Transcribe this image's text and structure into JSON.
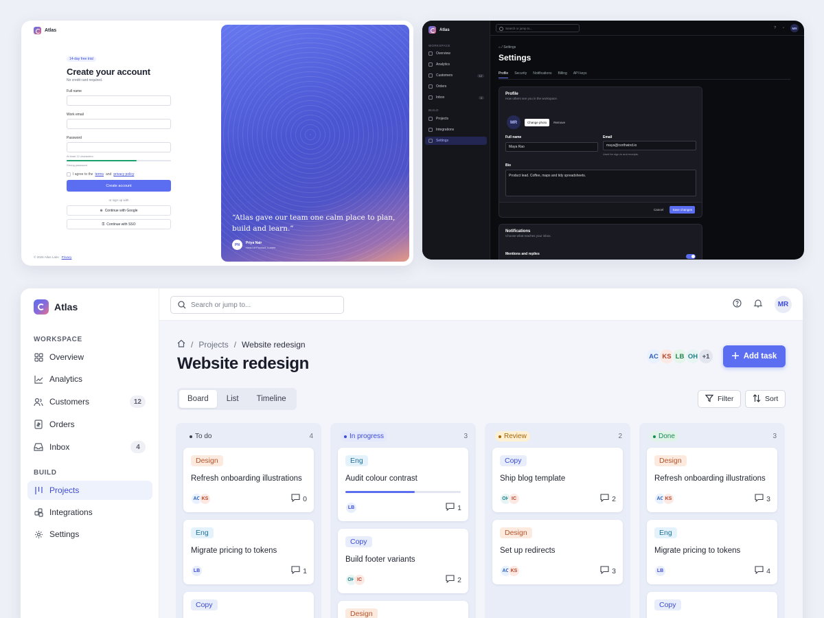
{
  "signup": {
    "brand": "Atlas",
    "trial_badge": "14-day free trial",
    "title": "Create your account",
    "subtitle": "No credit card required.",
    "fields": [
      {
        "label": "Full name"
      },
      {
        "label": "Work email"
      },
      {
        "label": "Password",
        "hint": "At least 12 characters.",
        "strength_text": "Strong password",
        "strength": 0.67
      }
    ],
    "agree": {
      "prefix": "I agree to the",
      "terms": "terms",
      "and": "and",
      "privacy": "privacy policy"
    },
    "submit_label": "Create account",
    "divider": "or sign up with",
    "google_label": "Continue with Google",
    "sso_label": "Continue with SSO",
    "footer_text": "© 2026 Atlas Labs ·",
    "footer_link": "Privacy",
    "quote": "“Atlas gave our team one calm place to plan, build and learn.”",
    "author": {
      "initials": "PN",
      "name": "Priya Nair",
      "role": "Head of Product, Lumen"
    }
  },
  "settings": {
    "brand": "Atlas",
    "search_placeholder": "Search or jump to...",
    "user_initials": "MR",
    "sections": {
      "workspace": "WORKSPACE",
      "build": "BUILD"
    },
    "nav": [
      {
        "label": "Overview"
      },
      {
        "label": "Analytics"
      },
      {
        "label": "Customers",
        "count": "12"
      },
      {
        "label": "Orders"
      },
      {
        "label": "Inbox",
        "count": "4"
      },
      {
        "label": "Projects"
      },
      {
        "label": "Integrations"
      },
      {
        "label": "Settings"
      }
    ],
    "breadcrumb": "Settings",
    "title": "Settings",
    "tabs": [
      "Profile",
      "Security",
      "Notifications",
      "Billing",
      "API keys"
    ],
    "profile": {
      "heading": "Profile",
      "sub": "How others see you in the workspace.",
      "avatar": "MR",
      "change_photo": "Change photo",
      "remove": "Remove",
      "full_name_label": "Full name",
      "full_name": "Maya Rao",
      "email_label": "Email",
      "email": "maya@northwind.io",
      "email_help": "Used for sign-in and receipts.",
      "bio_label": "Bio",
      "bio": "Product lead. Coffee, maps and tidy spreadsheets.",
      "cancel": "Cancel",
      "save": "Save changes"
    },
    "notifications": {
      "heading": "Notifications",
      "sub": "Choose what reaches your inbox.",
      "item": "Mentions and replies",
      "item_on": true
    }
  },
  "board": {
    "brand": "Atlas",
    "sections": {
      "workspace": "WORKSPACE",
      "build": "BUILD"
    },
    "nav": [
      {
        "label": "Overview"
      },
      {
        "label": "Analytics"
      },
      {
        "label": "Customers",
        "count": "12"
      },
      {
        "label": "Orders"
      },
      {
        "label": "Inbox",
        "count": "4"
      },
      {
        "label": "Projects"
      },
      {
        "label": "Integrations"
      },
      {
        "label": "Settings"
      }
    ],
    "search_placeholder": "Search or jump to...",
    "user_initials": "MR",
    "breadcrumb": {
      "root": "Projects",
      "current": "Website redesign"
    },
    "title": "Website redesign",
    "members": [
      "AC",
      "KS",
      "LB",
      "OH"
    ],
    "members_more": "+1",
    "add_task": "Add task",
    "views": [
      "Board",
      "List",
      "Timeline"
    ],
    "filter": "Filter",
    "sort": "Sort",
    "columns": [
      {
        "name": "To do",
        "count": "4",
        "cards": [
          {
            "tag": "Design",
            "title": "Refresh onboarding illustrations",
            "avatars": [
              "AC",
              "KS"
            ],
            "comments": "0"
          },
          {
            "tag": "Eng",
            "title": "Migrate pricing to tokens",
            "avatars": [
              "LB"
            ],
            "comments": "1"
          },
          {
            "tag": "Copy"
          }
        ]
      },
      {
        "name": "In progress",
        "count": "3",
        "cards": [
          {
            "tag": "Eng",
            "title": "Audit colour contrast",
            "progress": 0.6,
            "avatars": [
              "LB"
            ],
            "comments": "1"
          },
          {
            "tag": "Copy",
            "title": "Build footer variants",
            "avatars": [
              "OH",
              "IC"
            ],
            "comments": "2"
          },
          {
            "tag": "Design"
          }
        ]
      },
      {
        "name": "Review",
        "count": "2",
        "cards": [
          {
            "tag": "Copy",
            "title": "Ship blog template",
            "avatars": [
              "OH",
              "IC"
            ],
            "comments": "2"
          },
          {
            "tag": "Design",
            "title": "Set up redirects",
            "avatars": [
              "AC",
              "KS"
            ],
            "comments": "3"
          }
        ]
      },
      {
        "name": "Done",
        "count": "3",
        "cards": [
          {
            "tag": "Design",
            "title": "Refresh onboarding illustrations",
            "avatars": [
              "AC",
              "KS"
            ],
            "comments": "3"
          },
          {
            "tag": "Eng",
            "title": "Migrate pricing to tokens",
            "avatars": [
              "LB"
            ],
            "comments": "4"
          },
          {
            "tag": "Copy"
          }
        ]
      }
    ]
  },
  "colors": {
    "accent": "#5b6df0",
    "todo": "#3a3e4a",
    "in_progress": "#3c4bd6",
    "review": "#a5650a",
    "done": "#1a8a55"
  }
}
